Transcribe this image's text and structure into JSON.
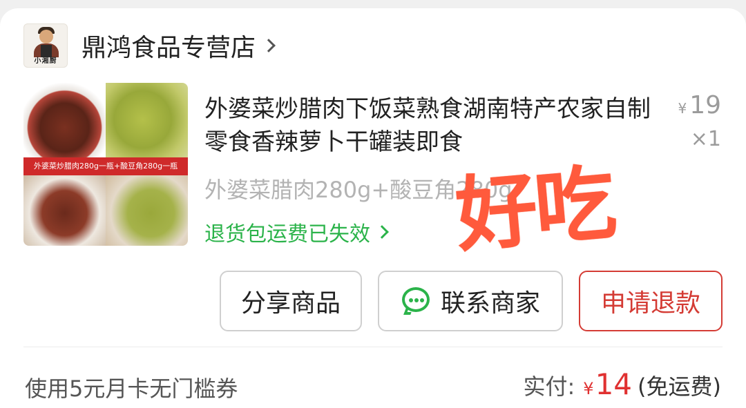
{
  "shop": {
    "name": "鼎鸿食品专营店",
    "logo_text": "小湘厨"
  },
  "product": {
    "title": "外婆菜炒腊肉下饭菜熟食湖南特产农家自制零食香辣萝卜干罐装即食",
    "image_banner": "外婆菜炒腊肉280g一瓶+酸豆角280g一瓶",
    "price_symbol": "¥",
    "price": "19",
    "quantity": "×1",
    "sku": "外婆菜腊肉280g+酸豆角280g",
    "return_shipping": "退货包运费已失效"
  },
  "sticker": "好吃",
  "actions": {
    "share": "分享商品",
    "contact": "联系商家",
    "refund": "申请退款"
  },
  "footer": {
    "coupon": "使用5元月卡无门槛券",
    "paid_label": "实付:",
    "paid_symbol": "¥",
    "paid_amount": "14",
    "shipping_note": "(免运费)"
  },
  "colors": {
    "accent_red": "#d43b34",
    "price_red": "#e03131",
    "green": "#2bb34a",
    "sticker": "#ff5a3c"
  }
}
